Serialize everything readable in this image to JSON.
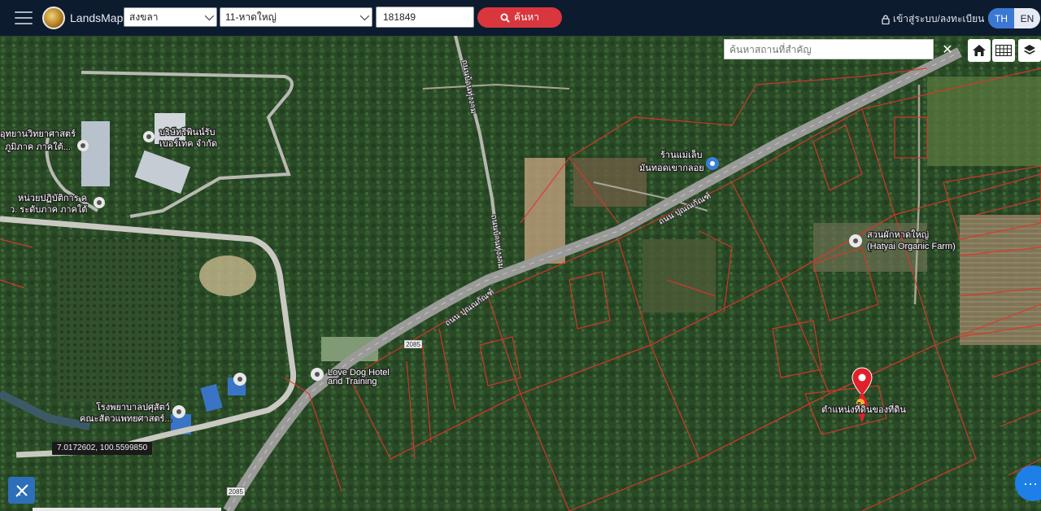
{
  "header": {
    "brand": "LandsMaps",
    "province_select": "สงขลา",
    "district_select": "11-หาดใหญ่",
    "parcel_number": "181849",
    "search_label": "ค้นหา",
    "login_label": "เข้าสู่ระบบ/ลงทะเบียน",
    "lang_th": "TH",
    "lang_en": "EN"
  },
  "map_controls": {
    "place_search_placeholder": "ค้นหาสถานที่สำคัญ",
    "close_symbol": "✕",
    "coordinates": "7.0172602, 100.5599850",
    "more_symbol": "···"
  },
  "map_labels": {
    "poi_science_park": "อุทยานวิทยาศาสตร์",
    "poi_science_park_2": "ภูมิภาค ภาคใต้...",
    "poi_rubber_company": "บริษัทรีพินน์รับ",
    "poi_rubber_company_2": "เบอร์เทค จำกัด",
    "poi_lab_unit": "หน่วยปฏิบัติการ ค",
    "poi_lab_unit_2": "ว. ระดับภาค ภาคใต้",
    "poi_shop": "ร้านแม่เล็บ",
    "poi_shop_2": "มันทอดเขากลอย",
    "poi_organic_farm": "สวนผักหาดใหญ่",
    "poi_organic_farm_2": "(Hatyai Organic Farm)",
    "poi_love_dog": "Love Dog Hotel",
    "poi_love_dog_2": "and Training",
    "poi_vet_hospital": "โรงพยาบาลปศุสัตว์",
    "poi_vet_hospital_2": "คณะสัตวแพทยศาสตร์...",
    "road_main": "ถนน ปุณณกัณฑ์",
    "road_main_2": "ถนน ปุณณกัณฑ์",
    "road_side": "ถนนบ้านทุ่งงาม",
    "road_side_2": "ถนนบ้านทุ่งงาม",
    "route_number": "2085",
    "route_number_2": "2085",
    "marker_label": "ตำแหน่งที่ดินของที่ดิน"
  },
  "colors": {
    "topbar": "#0d1b2e",
    "search_button": "#d9363e",
    "lang_active": "#3a78d4",
    "parcel_lines": "#e0342c",
    "marker": "#e0202a",
    "fab": "#1e80e6"
  },
  "icons": {
    "menu": "hamburger-icon",
    "search": "magnifier-icon",
    "login": "lock-icon",
    "home": "home-icon",
    "grid": "grid-icon",
    "layers": "layers-icon",
    "measure": "ruler-icon",
    "poi": "poi-pin-icon",
    "marker": "location-pin-icon"
  }
}
